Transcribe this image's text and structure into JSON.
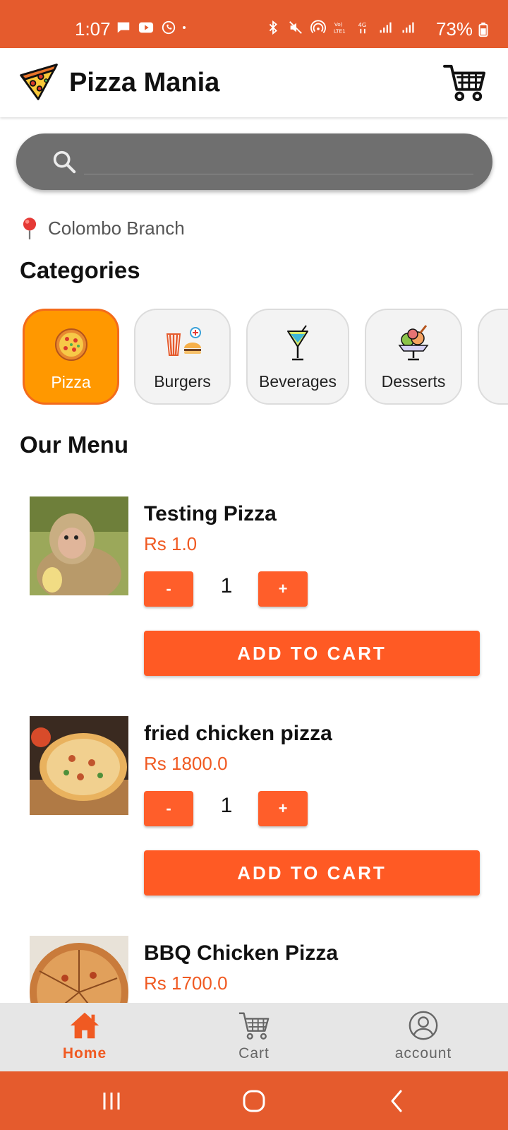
{
  "status_bar": {
    "time": "1:07",
    "battery": "73%"
  },
  "app_bar": {
    "title": "Pizza Mania"
  },
  "search": {
    "placeholder": ""
  },
  "location": {
    "branch": "Colombo Branch"
  },
  "categories_section": {
    "title": "Categories",
    "items": [
      {
        "label": "Pizza",
        "icon": "pizza-icon",
        "active": true
      },
      {
        "label": "Burgers",
        "icon": "burger-fries-icon",
        "active": false
      },
      {
        "label": "Beverages",
        "icon": "cocktail-icon",
        "active": false
      },
      {
        "label": "Desserts",
        "icon": "ice-cream-icon",
        "active": false
      }
    ]
  },
  "menu_section": {
    "title": "Our Menu",
    "items": [
      {
        "name": "Testing Pizza",
        "price": "Rs 1.0",
        "quantity": "1",
        "minus_label": "-",
        "plus_label": "+",
        "add_label": "ADD TO CART",
        "image": "monkey-photo"
      },
      {
        "name": "fried chicken pizza",
        "price": "Rs 1800.0",
        "quantity": "1",
        "minus_label": "-",
        "plus_label": "+",
        "add_label": "ADD TO CART",
        "image": "pizza-photo"
      },
      {
        "name": "BBQ Chicken Pizza",
        "price": "Rs 1700.0",
        "image": "pizza-slices-photo"
      }
    ]
  },
  "bottom_nav": {
    "items": [
      {
        "label": "Home",
        "icon": "home-icon",
        "active": true
      },
      {
        "label": "Cart",
        "icon": "cart-icon",
        "active": false
      },
      {
        "label": "account",
        "icon": "account-icon",
        "active": false
      }
    ]
  },
  "colors": {
    "brand": "#E55B2D",
    "accent": "#FF5A24",
    "active_category": "#FF9800"
  }
}
